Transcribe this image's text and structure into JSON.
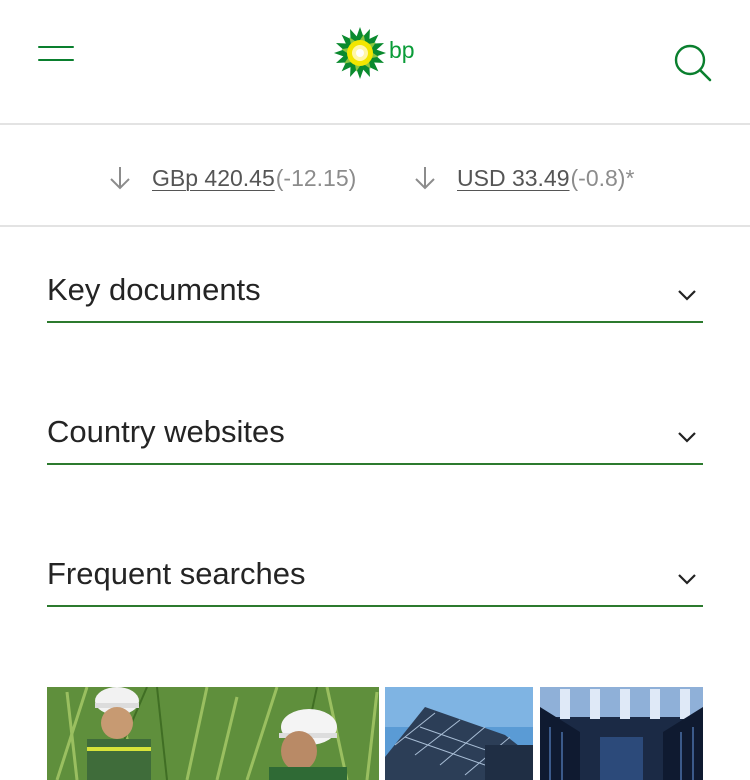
{
  "header": {
    "logo_text": "bp",
    "menu_icon": "hamburger-menu-icon",
    "search_icon": "search-icon"
  },
  "ticker": {
    "items": [
      {
        "direction": "down",
        "price": "GBp 420.45 ",
        "change": "(-12.15)"
      },
      {
        "direction": "down",
        "price": "USD 33.49 ",
        "change": "(-0.8)*"
      }
    ]
  },
  "sections": [
    {
      "title": "Key documents"
    },
    {
      "title": "Country websites"
    },
    {
      "title": "Frequent searches"
    }
  ],
  "colors": {
    "brand_green": "#0a7f2e",
    "logo_yellow": "#f2e600",
    "divider": "#e3e3e3"
  }
}
